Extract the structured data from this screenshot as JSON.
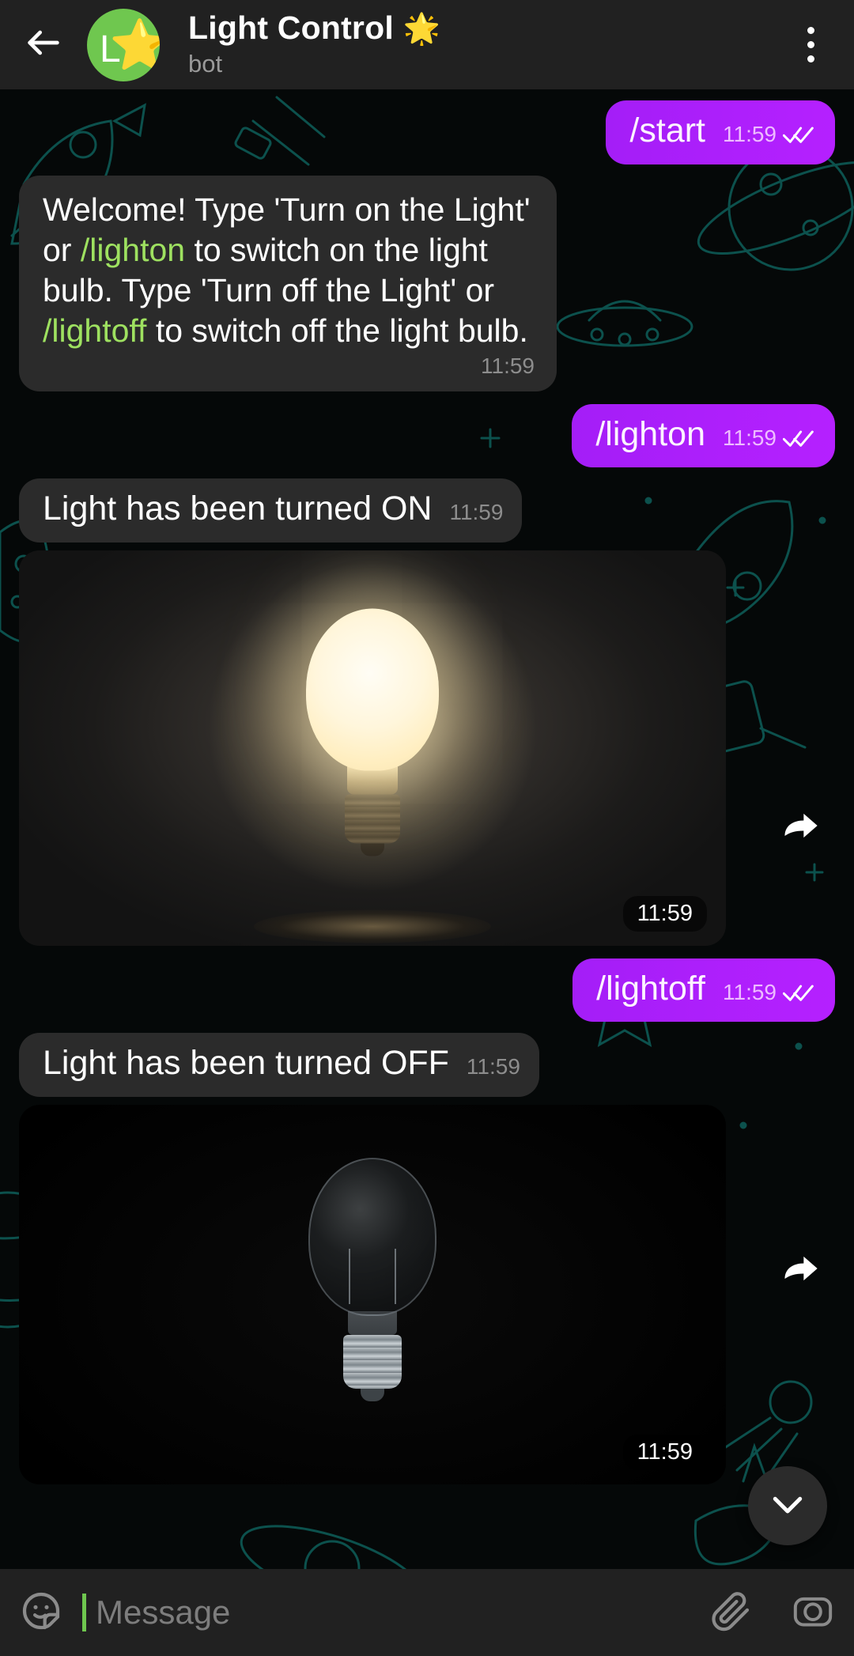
{
  "header": {
    "back_icon": "back-arrow-icon",
    "avatar_letter": "L",
    "avatar_emoji": "⭐",
    "avatar_color": "#6fc74f",
    "title": "Light Control",
    "title_emoji": "🌟",
    "subtitle": "bot",
    "menu_icon": "overflow-menu-icon"
  },
  "theme": {
    "outgoing_bubble": "#ab1cff",
    "incoming_bubble": "#2b2b2b",
    "command_link": "#9ee160",
    "wallpaper": "#050808",
    "wallpaper_doodle": "#0f6a64"
  },
  "messages": [
    {
      "id": "msg-start",
      "direction": "out",
      "text": "/start",
      "time": "11:59",
      "status": "read"
    },
    {
      "id": "msg-welcome",
      "direction": "in",
      "segments": [
        {
          "text": "Welcome! Type 'Turn on the Light' or ",
          "kind": "plain"
        },
        {
          "text": "/lighton",
          "kind": "command"
        },
        {
          "text": " to switch on the light bulb. Type 'Turn off the Light' or ",
          "kind": "plain"
        },
        {
          "text": "/lightoff",
          "kind": "command"
        },
        {
          "text": " to switch off the light bulb.",
          "kind": "plain"
        }
      ],
      "time": "11:59"
    },
    {
      "id": "msg-lighton",
      "direction": "out",
      "text": "/lighton",
      "time": "11:59",
      "status": "read"
    },
    {
      "id": "msg-turned-on",
      "direction": "in",
      "text": "Light has been turned ON",
      "time": "11:59"
    },
    {
      "id": "msg-photo-on",
      "direction": "in",
      "kind": "photo",
      "photo_description": "glowing incandescent light bulb turned on against dark background",
      "time": "11:59",
      "forward_icon": "forward-arrow-icon"
    },
    {
      "id": "msg-lightoff",
      "direction": "out",
      "text": "/lightoff",
      "time": "11:59",
      "status": "read"
    },
    {
      "id": "msg-turned-off",
      "direction": "in",
      "text": "Light has been turned OFF",
      "time": "11:59"
    },
    {
      "id": "msg-photo-off",
      "direction": "in",
      "kind": "photo",
      "photo_description": "unlit clear glass light bulb against black background",
      "time": "11:59",
      "forward_icon": "forward-arrow-icon"
    }
  ],
  "scroll_fab": {
    "icon": "chevron-down-icon"
  },
  "composer": {
    "emoji_icon": "sticker-smiley-icon",
    "placeholder": "Message",
    "attach_icon": "paperclip-icon",
    "camera_icon": "camera-icon"
  }
}
